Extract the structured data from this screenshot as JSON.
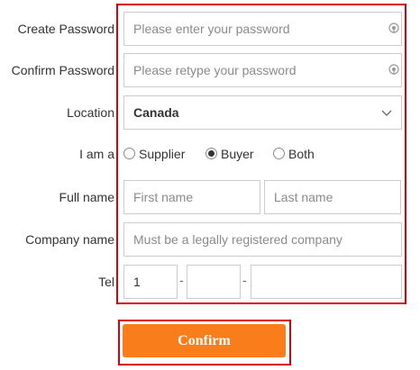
{
  "form": {
    "create_password": {
      "label": "Create Password",
      "placeholder": "Please enter your password",
      "value": ""
    },
    "confirm_password": {
      "label": "Confirm Password",
      "placeholder": "Please retype your password",
      "value": ""
    },
    "location": {
      "label": "Location",
      "selected": "Canada"
    },
    "role": {
      "label": "I am a",
      "options": [
        "Supplier",
        "Buyer",
        "Both"
      ],
      "selected": "Buyer"
    },
    "full_name": {
      "label": "Full name",
      "first_placeholder": "First name",
      "last_placeholder": "Last name"
    },
    "company_name": {
      "label": "Company name",
      "placeholder": "Must be a legally registered company"
    },
    "tel": {
      "label": "Tel",
      "country_code": "1",
      "area_code": "",
      "number": "",
      "separator": "-"
    }
  },
  "confirm_button": {
    "label": "Confirm"
  },
  "colors": {
    "highlight_border": "#d9000b",
    "button_bg": "#f97d1b",
    "button_text": "#ffffff",
    "input_border": "#cccccc",
    "placeholder": "#8a8a8a"
  },
  "icons": {
    "password_toggle": "eye-icon",
    "dropdown": "chevron-down-icon"
  }
}
